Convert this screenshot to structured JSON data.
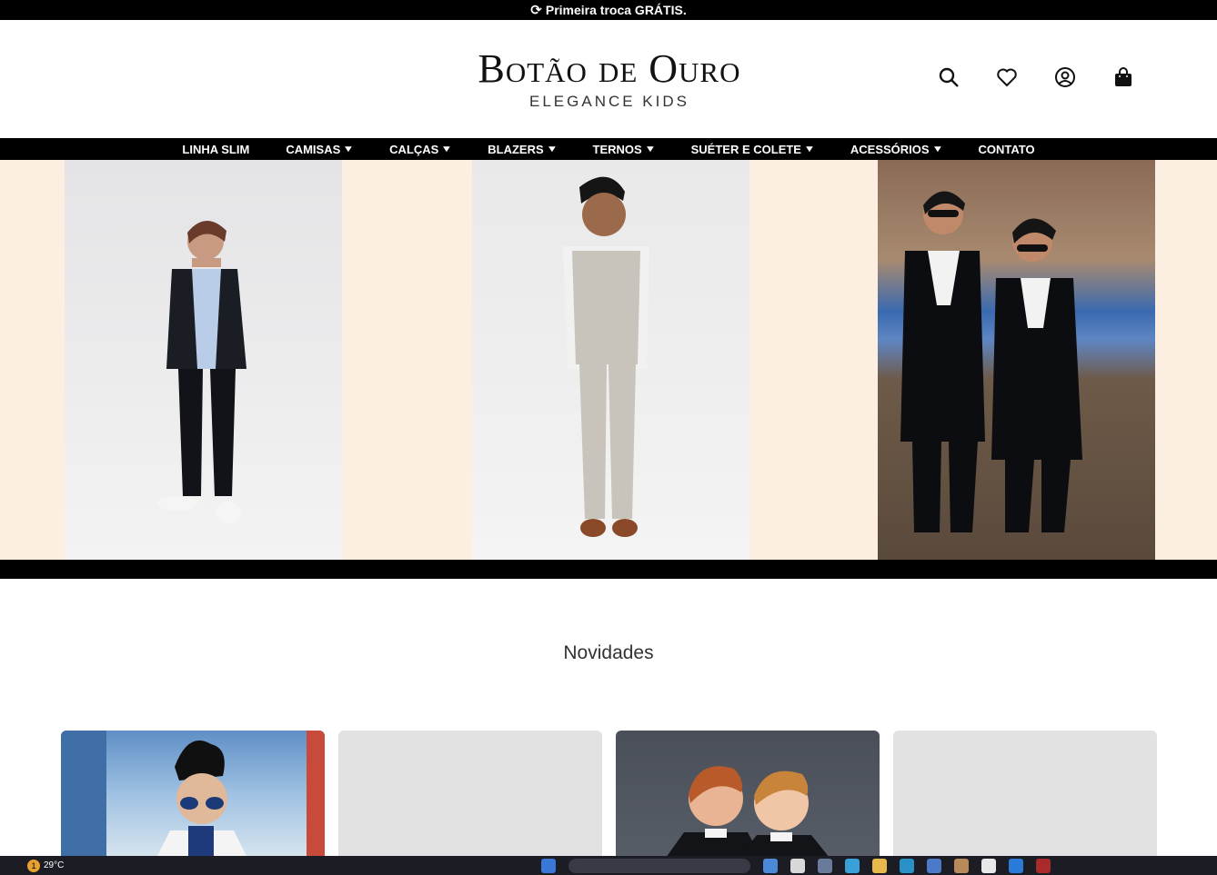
{
  "announcement": {
    "icon": "repeat-icon",
    "text": "Primeira troca GRÁTIS."
  },
  "logo": {
    "brand": "Botão de Ouro",
    "tagline": "ELEGANCE KIDS"
  },
  "header_icons": [
    "search-icon",
    "heart-icon",
    "user-icon",
    "shopping-bag-icon"
  ],
  "nav": {
    "items": [
      {
        "label": "LINHA SLIM",
        "dropdown": false
      },
      {
        "label": "CAMISAS",
        "dropdown": true
      },
      {
        "label": "CALÇAS",
        "dropdown": true
      },
      {
        "label": "BLAZERS",
        "dropdown": true
      },
      {
        "label": "TERNOS",
        "dropdown": true
      },
      {
        "label": "SUÉTER E COLETE",
        "dropdown": true
      },
      {
        "label": "ACESSÓRIOS",
        "dropdown": true
      },
      {
        "label": "CONTATO",
        "dropdown": false
      }
    ]
  },
  "banner": {
    "background": "#fcefe2",
    "photos": [
      "boy in black blazer and light blue shirt",
      "boy in beige double-breasted vest suit",
      "two boys in black tuxedos with sunglasses"
    ]
  },
  "section": {
    "title": "Novidades"
  },
  "products": [
    {
      "image": "boy with sunglasses in white blazer"
    },
    {
      "image": ""
    },
    {
      "image": "two boys in black tuxedos"
    },
    {
      "image": ""
    }
  ],
  "taskbar": {
    "weather_badge": "1",
    "temperature": "29°C"
  },
  "colors": {
    "accent": "#000000",
    "banner_bg": "#fcefe2",
    "card_placeholder": "#e2e2e2"
  }
}
